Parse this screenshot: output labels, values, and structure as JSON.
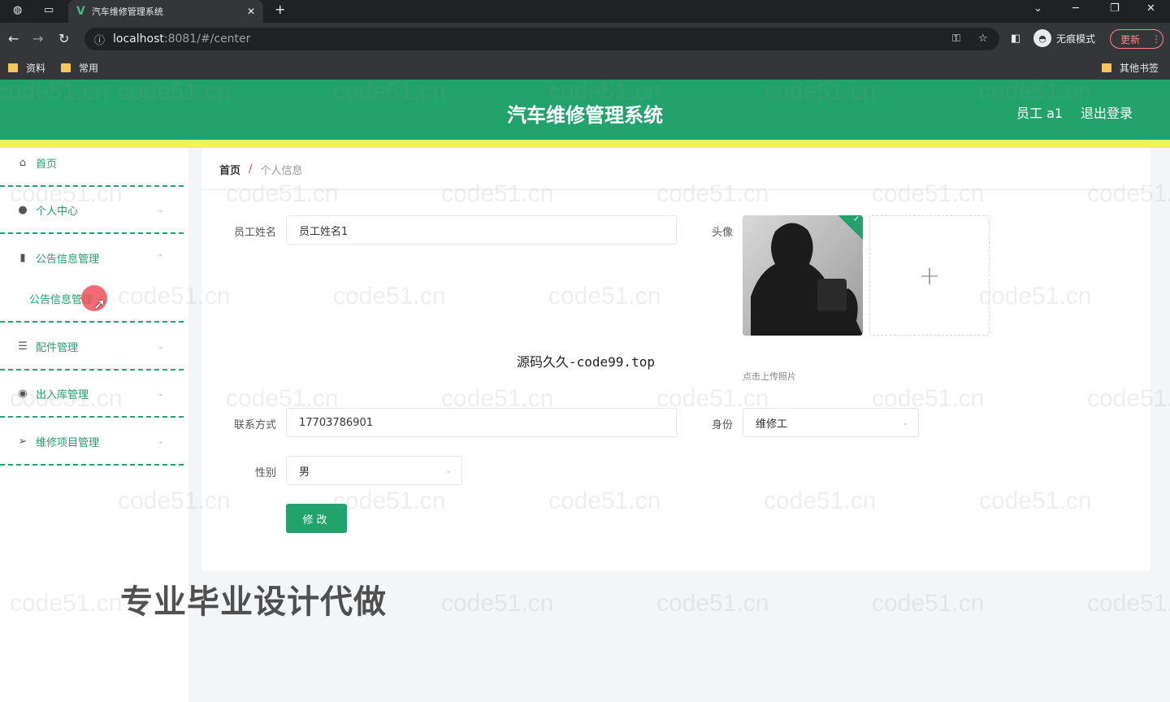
{
  "browser": {
    "tab_title": "汽车维修管理系统",
    "tab_icon": "vue-logo-icon",
    "close_glyph": "✕",
    "new_tab_glyph": "+",
    "url_host": "localhost",
    "url_path": ":8081/#/center",
    "incognito_label": "无痕模式",
    "update_label": "更新",
    "bookmarks": [
      "资料",
      "常用"
    ],
    "other_bookmarks": "其他书签"
  },
  "header": {
    "title": "汽车维修管理系统",
    "user_label": "员工 a1",
    "logout_label": "退出登录",
    "brand_color": "#22a36b",
    "accent_color": "#f3f156"
  },
  "sidebar": {
    "items": [
      {
        "label": "首页",
        "icon": "home-icon"
      },
      {
        "label": "个人中心",
        "icon": "user-icon"
      },
      {
        "label": "公告信息管理",
        "icon": "bar-chart-icon"
      },
      {
        "label": "公告信息管理",
        "icon": ""
      },
      {
        "label": "配件管理",
        "icon": "sliders-icon"
      },
      {
        "label": "出入库管理",
        "icon": "location-icon"
      },
      {
        "label": "维修项目管理",
        "icon": "send-icon"
      }
    ]
  },
  "breadcrumb": {
    "home": "首页",
    "separator": "/",
    "current": "个人信息"
  },
  "form": {
    "name_label": "员工姓名",
    "name_value": "员工姓名1",
    "avatar_label": "头像",
    "upload_tip": "点击上传照片",
    "phone_label": "联系方式",
    "phone_value": "17703786901",
    "role_label": "身份",
    "role_value": "维修工",
    "gender_label": "性别",
    "gender_value": "男",
    "submit_label": "修改"
  },
  "overlay": {
    "source_text": "源码久久-code99.top",
    "promo_text": "专业毕业设计代做",
    "watermark": "code51.cn"
  }
}
